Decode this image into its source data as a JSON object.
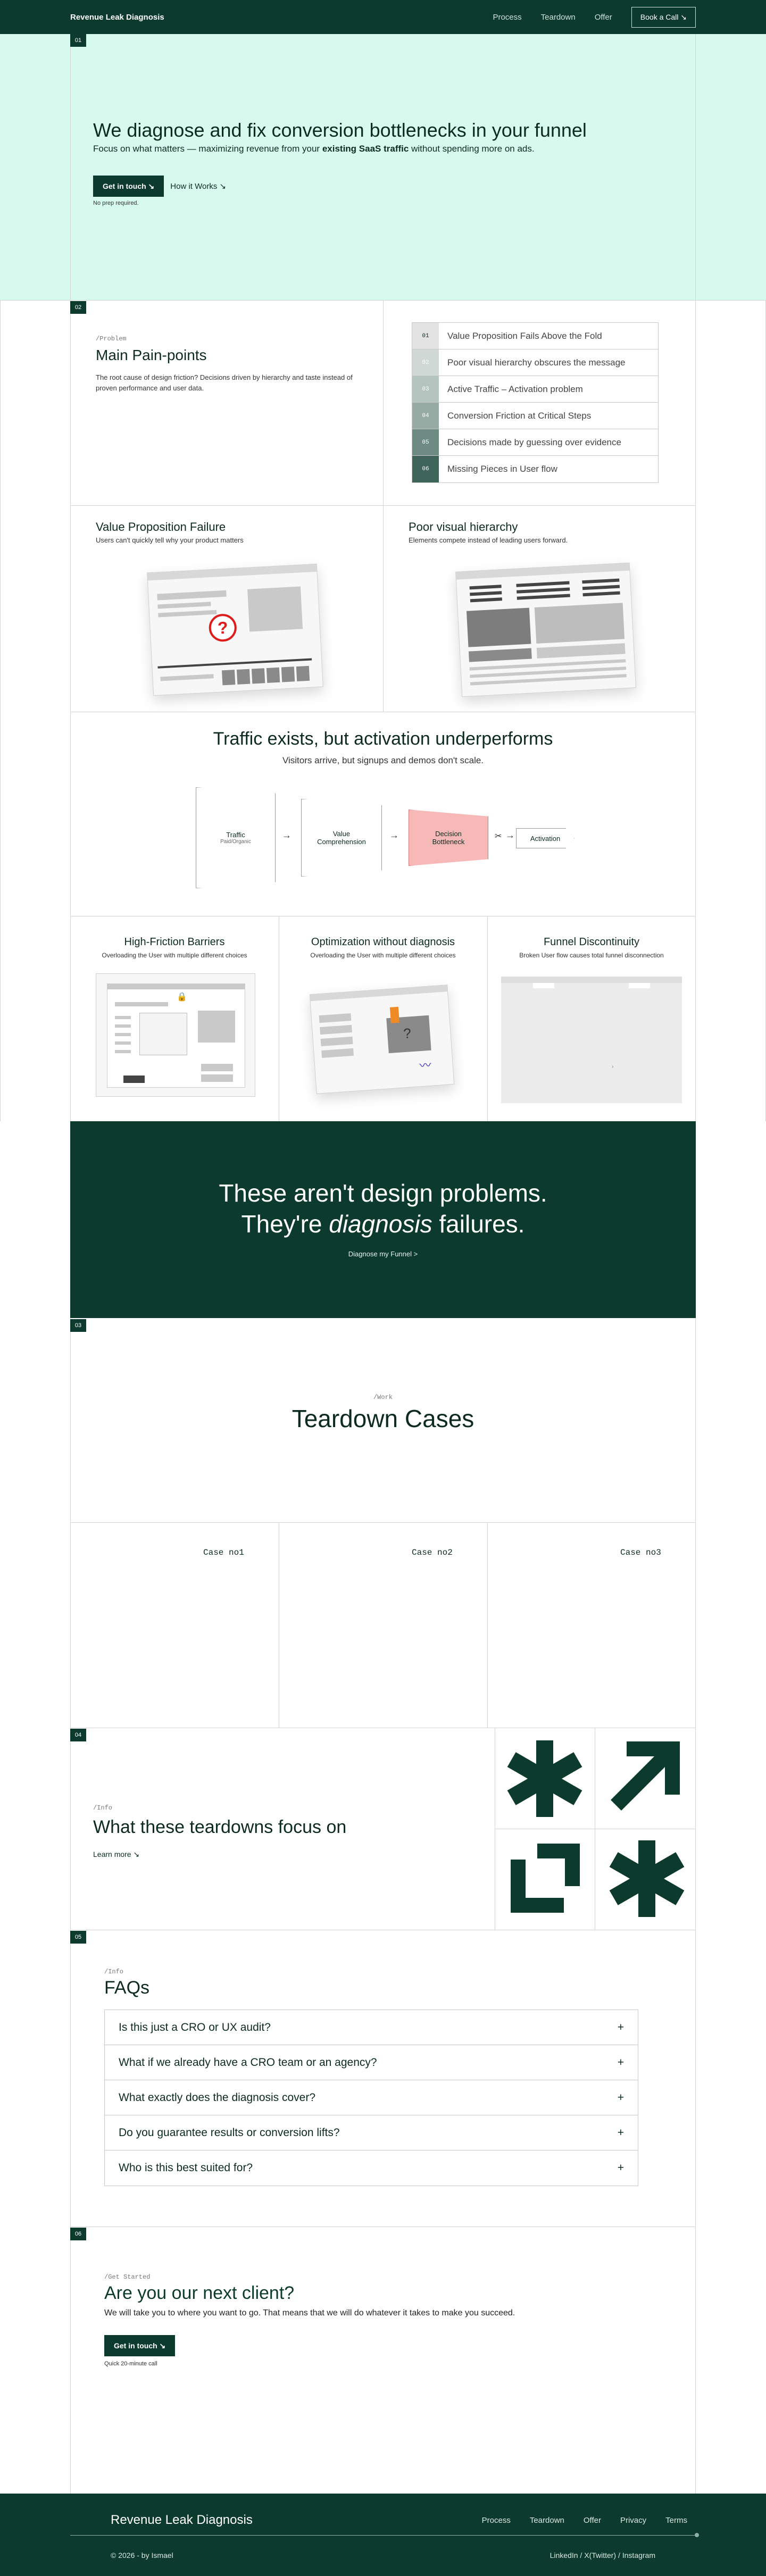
{
  "nav": {
    "brand": "Revenue Leak Diagnosis",
    "links": [
      "Process",
      "Teardown",
      "Offer"
    ],
    "cta": "Book a Call ↘"
  },
  "hero": {
    "section": "01",
    "title": "We diagnose and fix conversion bottlenecks in your funnel",
    "sub_before": "Focus on what matters — maximizing revenue from your ",
    "sub_bold": "existing SaaS traffic",
    "sub_after": " without spending more on ads.",
    "primary": "Get in touch ↘",
    "secondary": "How it Works ↘",
    "note": "No prep required."
  },
  "pain": {
    "section": "02",
    "tag": "/Problem",
    "title": "Main Pain-points",
    "desc": "The root cause of design friction? Decisions driven by hierarchy and taste instead of proven performance and user data.",
    "items": [
      {
        "num": "01",
        "label": "Value Proposition Fails Above the Fold",
        "bg": "#e3e3e3",
        "fg": "#0c2a22"
      },
      {
        "num": "02",
        "label": "Poor visual hierarchy obscures the message",
        "bg": "#cfd8d5",
        "fg": "#ffffff"
      },
      {
        "num": "03",
        "label": "Active Traffic – Activation problem",
        "bg": "#b4c4bf",
        "fg": "#ffffff"
      },
      {
        "num": "04",
        "label": "Conversion Friction at Critical Steps",
        "bg": "#95aba4",
        "fg": "#ffffff"
      },
      {
        "num": "05",
        "label": "Decisions made by guessing over evidence",
        "bg": "#6f8c84",
        "fg": "#ffffff"
      },
      {
        "num": "06",
        "label": "Missing Pieces in User flow",
        "bg": "#3f655a",
        "fg": "#ffffff"
      }
    ]
  },
  "cards": {
    "vp_title": "Value Proposition Failure",
    "vp_sub": "Users can't quickly tell why your product matters",
    "pvh_title": "Poor visual hierarchy",
    "pvh_sub": "Elements compete instead of leading users forward."
  },
  "traffic": {
    "title": "Traffic exists, but activation underperforms",
    "sub": "Visitors arrive, but signups and demos don't scale.",
    "flow": {
      "traffic": "Traffic",
      "traffic_sub": "Paid/Organic",
      "value": "Value",
      "value_sub": "Comprehension",
      "decision": "Decision",
      "decision_sub": "Bottleneck",
      "activation": "Activation"
    }
  },
  "three": [
    {
      "title": "High-Friction Barriers",
      "sub": "Overloading the User with multiple different choices"
    },
    {
      "title": "Optimization without diagnosis",
      "sub": "Overloading the User with multiple different choices"
    },
    {
      "title": "Funnel Discontinuity",
      "sub": "Broken User flow causes total funnel disconnection"
    }
  ],
  "band": {
    "line1": "These aren't design problems.",
    "line2_before": "They're ",
    "line2_italic": "diagnosis",
    "line2_after": " failures.",
    "cta": "Diagnose my Funnel >"
  },
  "teardown": {
    "section": "03",
    "tag": "/Work",
    "title": "Teardown Cases",
    "cases": [
      "Case no1",
      "Case no2",
      "Case no3"
    ]
  },
  "focus": {
    "section": "04",
    "tag": "/Info",
    "title": "What these teardowns focus on",
    "link": "Learn more ↘"
  },
  "faq": {
    "section": "05",
    "tag": "/Info",
    "title": "FAQs",
    "items": [
      "Is this just a CRO or UX audit?",
      "What if we already have a CRO team or an agency?",
      "What exactly does the diagnosis cover?",
      "Do you guarantee results or conversion lifts?",
      "Who is this best suited for?"
    ],
    "plus": "+"
  },
  "client": {
    "section": "06",
    "tag": "/Get Started",
    "title": "Are you our next client?",
    "sub": "We will take you to where you want to go. That means that we will do whatever it takes to make you succeed.",
    "btn": "Get in touch ↘",
    "note": "Quick 20-minute call"
  },
  "footer": {
    "brand": "Revenue Leak Diagnosis",
    "links": [
      "Process",
      "Teardown",
      "Offer",
      "Privacy",
      "Terms"
    ],
    "copy": "© 2026 - by Ismael",
    "social": "LinkedIn / X(Twitter) / Instagram"
  },
  "colors": {
    "primary": "#0c3b2e",
    "hero_bg": "#d6fbee",
    "bottleneck": "#f7b8b8"
  }
}
